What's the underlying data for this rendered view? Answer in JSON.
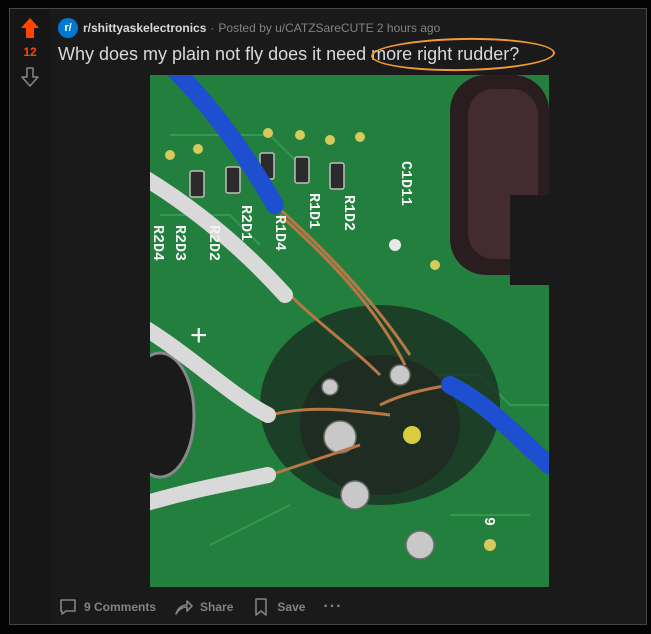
{
  "post": {
    "score": "12",
    "subreddit": "r/shittyaskelectronics",
    "separator": "·",
    "posted_by": "Posted by u/CATZSareCUTE 2 hours ago",
    "title": "Why does my plain not fly does it need more right rudder?",
    "sub_icon_text": "r/"
  },
  "image": {
    "board_labels": [
      "C1D11",
      "R1D2",
      "R1D1",
      "R1D4",
      "R2D1",
      "R2D2",
      "R2D3",
      "R2D4",
      "9"
    ]
  },
  "actions": {
    "comments": "9 Comments",
    "share": "Share",
    "save": "Save",
    "more": "···"
  },
  "colors": {
    "accent": "#ff4500",
    "annotation": "#f39a36",
    "subreddit_icon": "#0079d3"
  }
}
